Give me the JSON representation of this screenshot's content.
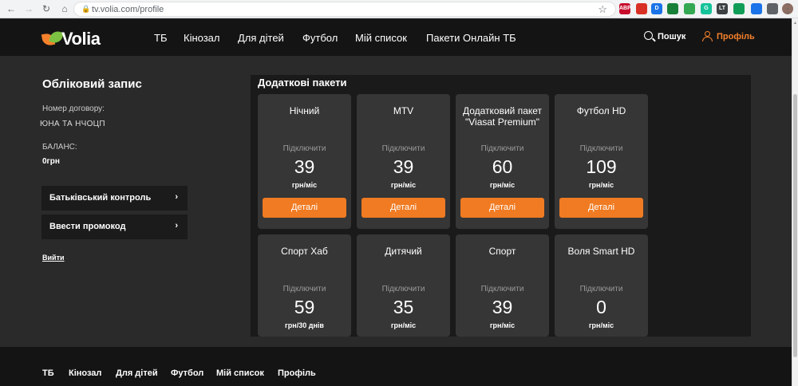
{
  "browser": {
    "url": "tv.volia.com/profile",
    "extensions": [
      {
        "name": "adblock-plus-icon",
        "label": "ABP",
        "color": "#c70d2c"
      },
      {
        "name": "extension-red-icon",
        "label": "",
        "color": "#d93025"
      },
      {
        "name": "extension-d-icon",
        "label": "D",
        "color": "#1a73e8"
      },
      {
        "name": "extension-green-icon",
        "label": "",
        "color": "#188038"
      },
      {
        "name": "extension-doc-icon",
        "label": "",
        "color": "#34a853"
      },
      {
        "name": "grammarly-icon",
        "label": "G",
        "color": "#15c39a"
      },
      {
        "name": "extension-lt-icon",
        "label": "LT",
        "color": "#3c4043"
      },
      {
        "name": "extension-check-icon",
        "label": "",
        "color": "#0f9d58"
      },
      {
        "name": "extension-blue-icon",
        "label": "",
        "color": "#1a73e8"
      },
      {
        "name": "puzzle-icon",
        "label": "",
        "color": "#5f6368"
      }
    ]
  },
  "header": {
    "logo": "Volia",
    "nav": [
      "ТБ",
      "Кінозал",
      "Для дітей",
      "Футбол",
      "Мій список",
      "Пакети Онлайн ТБ"
    ],
    "search_label": "Пошук",
    "profile_label": "Профіль"
  },
  "account": {
    "title": "Обліковий запис",
    "contract_label": "Номер договору:",
    "contract_value": "ЮНА ТА НЧОЦП",
    "balance_label": "БАЛАНС:",
    "balance_value": "0грн",
    "buttons": [
      "Батьківський контроль",
      "Ввести промокод"
    ],
    "logout": "Вийти"
  },
  "packages": {
    "title": "Додаткові пакети",
    "connect_label": "Підключити",
    "details_label": "Деталі",
    "items": [
      {
        "name": "Нічний",
        "price": "39",
        "unit": "грн/міс"
      },
      {
        "name": "MTV",
        "price": "39",
        "unit": "грн/міс"
      },
      {
        "name": "Додатковий пакет \"Viasat Premium\"",
        "price": "60",
        "unit": "грн/міс"
      },
      {
        "name": "Футбол HD",
        "price": "109",
        "unit": "грн/міс"
      },
      {
        "name": "Спорт Хаб",
        "price": "59",
        "unit": "грн/30 днів"
      },
      {
        "name": "Дитячий",
        "price": "35",
        "unit": "грн/міс"
      },
      {
        "name": "Спорт",
        "price": "39",
        "unit": "грн/міс"
      },
      {
        "name": "Воля Smart HD",
        "price": "0",
        "unit": "грн/міс"
      }
    ]
  },
  "footer": {
    "nav": [
      "ТБ",
      "Кінозал",
      "Для дітей",
      "Футбол",
      "Мій список",
      "Профіль"
    ]
  }
}
